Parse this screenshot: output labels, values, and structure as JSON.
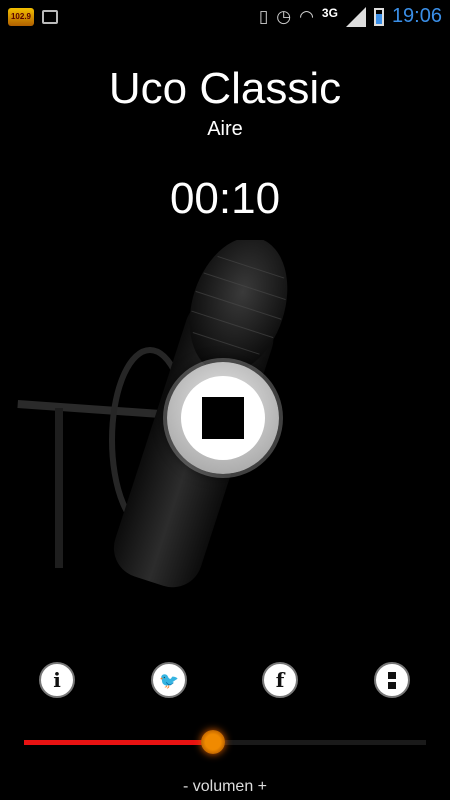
{
  "status_bar": {
    "app_logo_text": "102.9",
    "network_label": "3G",
    "time": "19:06",
    "icons": [
      "app-logo",
      "notification-icon",
      "vibrate-icon",
      "alarm-icon",
      "wifi-icon",
      "signal-icon",
      "battery-icon"
    ]
  },
  "player": {
    "station_name": "Uco Classic",
    "station_status": "Aire",
    "elapsed_time": "00:10",
    "control_icon": "stop-icon"
  },
  "actions": [
    {
      "name": "info",
      "glyph": "i",
      "icon": "info-icon"
    },
    {
      "name": "twitter",
      "glyph": "🐦",
      "icon": "twitter-icon"
    },
    {
      "name": "facebook",
      "glyph": "f",
      "icon": "facebook-icon"
    },
    {
      "name": "menu",
      "glyph": "",
      "icon": "menu-icon"
    }
  ],
  "volume": {
    "label": "- volumen +",
    "level": 0.47
  },
  "colors": {
    "background": "#000000",
    "accent_red": "#e81212",
    "thumb_orange": "#f08a00",
    "clock_blue": "#3a8ee6"
  }
}
